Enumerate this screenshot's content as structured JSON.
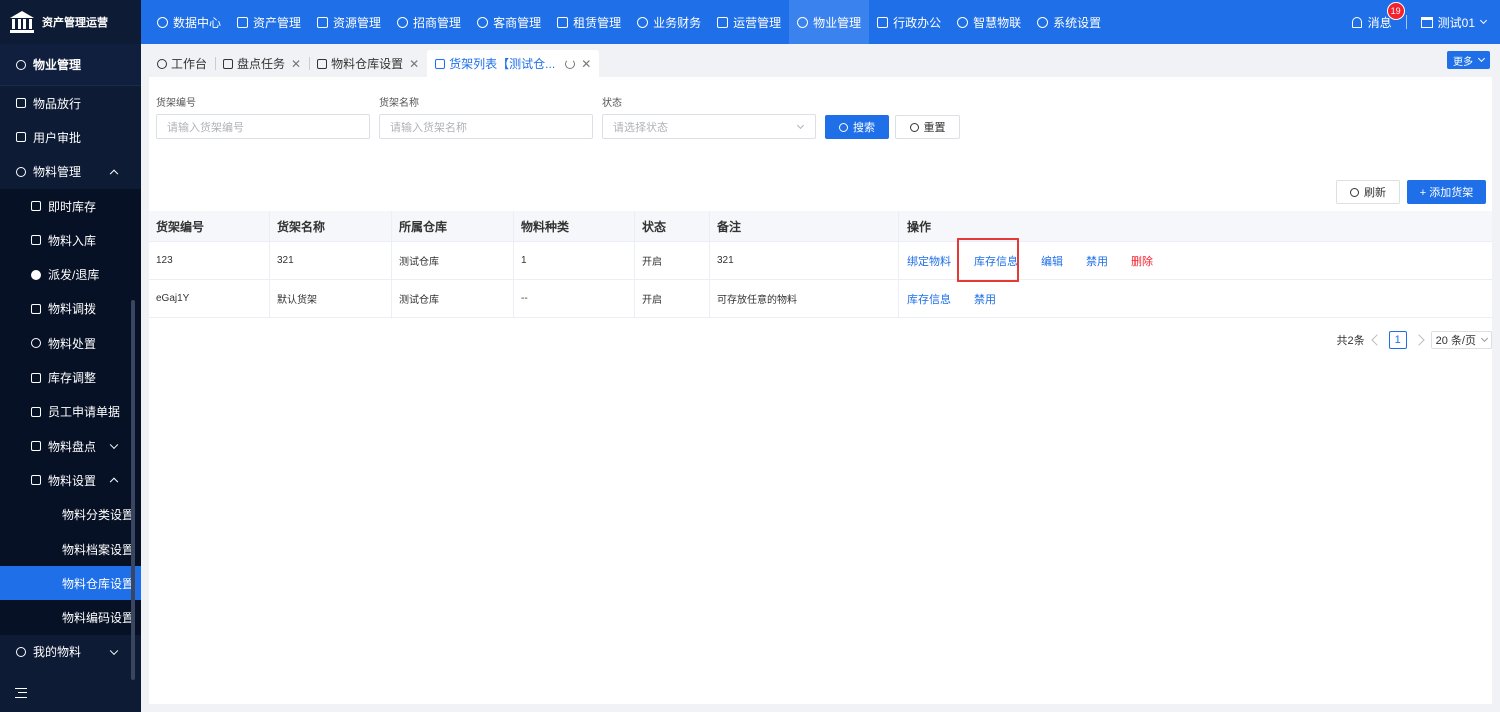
{
  "app": {
    "title": "资产管理运营"
  },
  "top_nav": [
    {
      "label": "数据中心",
      "icon": "dashboard-icon"
    },
    {
      "label": "资产管理",
      "icon": "cube-icon"
    },
    {
      "label": "资源管理",
      "icon": "chart-icon"
    },
    {
      "label": "招商管理",
      "icon": "diamond-icon"
    },
    {
      "label": "客商管理",
      "icon": "people-icon"
    },
    {
      "label": "租赁管理",
      "icon": "house-icon"
    },
    {
      "label": "业务财务",
      "icon": "coin-icon"
    },
    {
      "label": "运营管理",
      "icon": "grid-icon"
    },
    {
      "label": "物业管理",
      "icon": "home-icon",
      "active": true
    },
    {
      "label": "行政办公",
      "icon": "monitor-icon"
    },
    {
      "label": "智慧物联",
      "icon": "atom-icon"
    },
    {
      "label": "系统设置",
      "icon": "gear-icon"
    }
  ],
  "header_right": {
    "messages_label": "消息",
    "messages_count": "19",
    "user_name": "测试01"
  },
  "sidebar": {
    "title": "物业管理",
    "items": [
      {
        "label": "物品放行",
        "level": 0
      },
      {
        "label": "用户审批",
        "level": 0
      },
      {
        "label": "物料管理",
        "level": 0,
        "expanded": true
      },
      {
        "label": "即时库存",
        "level": 1
      },
      {
        "label": "物料入库",
        "level": 1
      },
      {
        "label": "派发/退库",
        "level": 1
      },
      {
        "label": "物料调拨",
        "level": 1
      },
      {
        "label": "物料处置",
        "level": 1
      },
      {
        "label": "库存调整",
        "level": 1
      },
      {
        "label": "员工申请单据",
        "level": 1
      },
      {
        "label": "物料盘点",
        "level": 1
      },
      {
        "label": "物料设置",
        "level": 1,
        "expanded": true
      },
      {
        "label": "物料分类设置",
        "level": 2
      },
      {
        "label": "物料档案设置",
        "level": 2
      },
      {
        "label": "物料仓库设置",
        "level": 2,
        "active": true
      },
      {
        "label": "物料编码设置",
        "level": 2
      },
      {
        "label": "我的物料",
        "level": 0
      }
    ]
  },
  "tabs": [
    {
      "label": "工作台"
    },
    {
      "label": "盘点任务"
    },
    {
      "label": "物料仓库设置"
    },
    {
      "label": "货架列表【测试仓...",
      "active": true
    }
  ],
  "more_label": "更多",
  "filters": {
    "code_label": "货架编号",
    "code_placeholder": "请输入货架编号",
    "name_label": "货架名称",
    "name_placeholder": "请输入货架名称",
    "status_label": "状态",
    "status_placeholder": "请选择状态",
    "search_label": "搜索",
    "reset_label": "重置"
  },
  "toolbar": {
    "refresh_label": "刷新",
    "add_label": "+ 添加货架"
  },
  "table": {
    "headers": [
      "货架编号",
      "货架名称",
      "所属仓库",
      "物料种类",
      "状态",
      "备注",
      "操作"
    ],
    "rows": [
      {
        "code": "123",
        "name": "321",
        "warehouse": "测试仓库",
        "kinds": "1",
        "status": "开启",
        "remark": "321",
        "ops": [
          "绑定物料",
          "库存信息",
          "编辑",
          "禁用",
          "删除"
        ]
      },
      {
        "code": "eGaj1Y",
        "name": "默认货架",
        "warehouse": "测试仓库",
        "kinds": "--",
        "status": "开启",
        "remark": "可存放任意的物料",
        "ops": [
          "库存信息",
          "禁用"
        ]
      }
    ]
  },
  "pagination": {
    "total": "共2条",
    "page": "1",
    "page_size": "20 条/页"
  },
  "colors": {
    "primary": "#1e6fe8",
    "sidebar_bg": "#0d1b35",
    "danger": "#f5222d",
    "highlight": "#e53935"
  }
}
